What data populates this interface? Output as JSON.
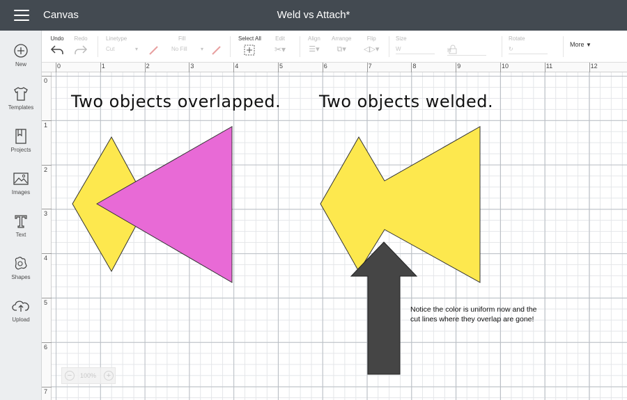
{
  "titlebar": {
    "app_name": "Canvas",
    "doc_title": "Weld vs Attach*"
  },
  "toolbar": {
    "undo": "Undo",
    "redo": "Redo",
    "linetype": "Linetype",
    "linetype_value": "Cut",
    "fill": "Fill",
    "fill_value": "No Fill",
    "select_all": "Select All",
    "edit": "Edit",
    "align": "Align",
    "arrange": "Arrange",
    "flip": "Flip",
    "size": "Size",
    "size_w": "W",
    "size_h": "H",
    "rotate": "Rotate",
    "more": "More"
  },
  "sidebar": {
    "items": [
      {
        "label": "New",
        "icon": "plus-circle-icon"
      },
      {
        "label": "Templates",
        "icon": "tshirt-icon"
      },
      {
        "label": "Projects",
        "icon": "bookmark-icon"
      },
      {
        "label": "Images",
        "icon": "image-icon"
      },
      {
        "label": "Text",
        "icon": "text-icon"
      },
      {
        "label": "Shapes",
        "icon": "shapes-icon"
      },
      {
        "label": "Upload",
        "icon": "cloud-upload-icon"
      }
    ]
  },
  "rulers": {
    "top": [
      "0",
      "1",
      "2",
      "3",
      "4",
      "5",
      "6",
      "7",
      "8",
      "9",
      "10",
      "11",
      "12"
    ],
    "left": [
      "0",
      "1",
      "2",
      "3",
      "4",
      "5",
      "6",
      "7"
    ]
  },
  "canvas": {
    "heading_left": "Two objects overlapped.",
    "heading_right": "Two objects welded.",
    "note_line1": "Notice the color is uniform now and the",
    "note_line2": "cut lines where they overlap are gone!"
  },
  "colors": {
    "yellow_shape": "#fde84e",
    "pink_shape": "#e86ad6",
    "arrow": "#454545"
  },
  "zoom": {
    "value": "100%"
  }
}
